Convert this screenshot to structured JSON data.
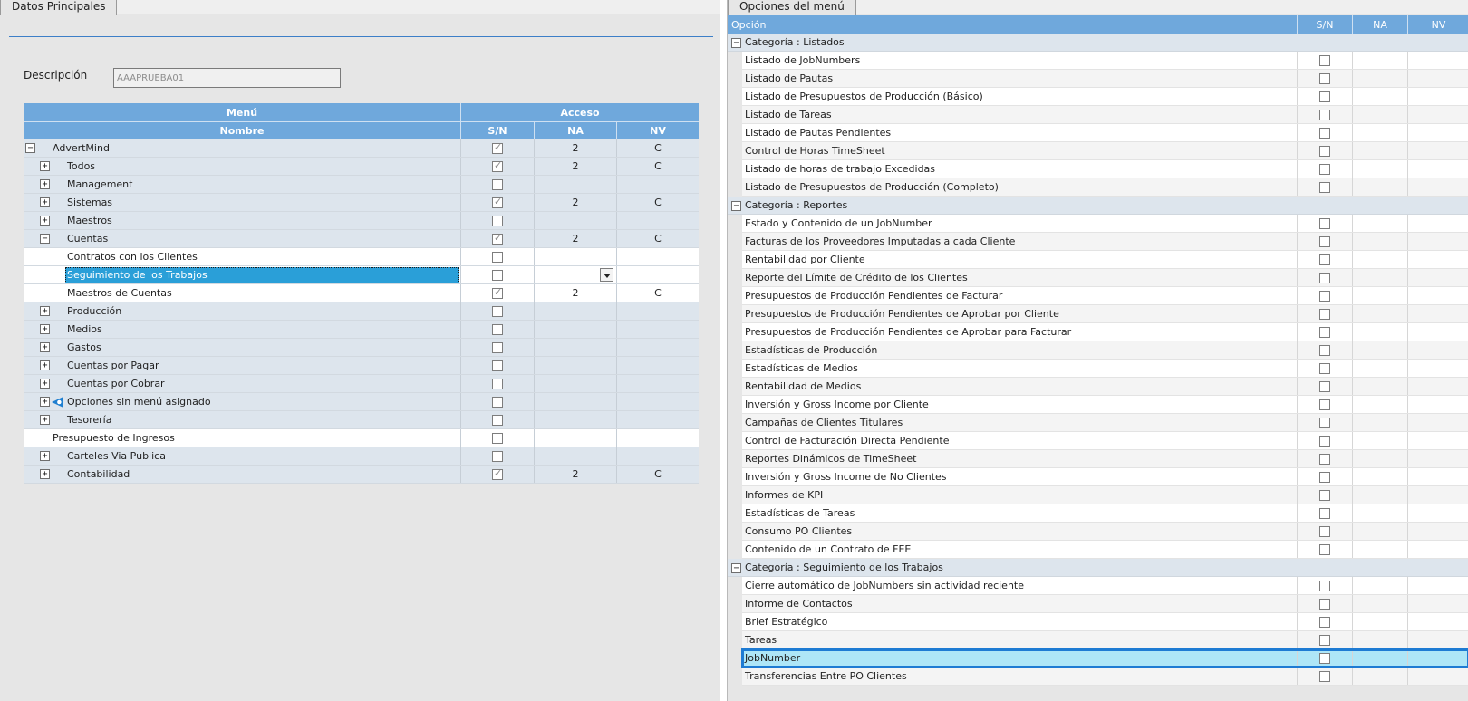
{
  "left": {
    "tab": "Datos Principales",
    "description_label": "Descripción",
    "description_value": "AAAPRUEBA01",
    "header": {
      "menu": "Menú",
      "acceso": "Acceso",
      "nombre": "Nombre",
      "sn": "S/N",
      "na": "NA",
      "nv": "NV"
    },
    "rows": [
      {
        "label": "AdvertMind",
        "level": 0,
        "exp": "−",
        "checked": true,
        "na": "2",
        "nv": "C",
        "white": false
      },
      {
        "label": "Todos",
        "level": 1,
        "exp": "+",
        "checked": true,
        "na": "2",
        "nv": "C",
        "white": false
      },
      {
        "label": "Management",
        "level": 1,
        "exp": "+",
        "checked": false,
        "na": "",
        "nv": "",
        "white": false
      },
      {
        "label": "Sistemas",
        "level": 1,
        "exp": "+",
        "checked": true,
        "na": "2",
        "nv": "C",
        "white": false
      },
      {
        "label": "Maestros",
        "level": 1,
        "exp": "+",
        "checked": false,
        "na": "",
        "nv": "",
        "white": false
      },
      {
        "label": "Cuentas",
        "level": 1,
        "exp": "−",
        "checked": true,
        "na": "2",
        "nv": "C",
        "white": false
      },
      {
        "label": "Contratos con los Clientes",
        "level": 2,
        "exp": "",
        "checked": false,
        "na": "",
        "nv": "",
        "white": true
      },
      {
        "label": "Seguimiento de los Trabajos",
        "level": 2,
        "exp": "",
        "checked": false,
        "na": "",
        "nv": "",
        "white": true,
        "selected": true,
        "dropdown": true
      },
      {
        "label": "Maestros de Cuentas",
        "level": 2,
        "exp": "",
        "checked": true,
        "na": "2",
        "nv": "C",
        "white": true
      },
      {
        "label": "Producción",
        "level": 1,
        "exp": "+",
        "checked": false,
        "na": "",
        "nv": "",
        "white": false
      },
      {
        "label": "Medios",
        "level": 1,
        "exp": "+",
        "checked": false,
        "na": "",
        "nv": "",
        "white": false
      },
      {
        "label": "Gastos",
        "level": 1,
        "exp": "+",
        "checked": false,
        "na": "",
        "nv": "",
        "white": false
      },
      {
        "label": "Cuentas por Pagar",
        "level": 1,
        "exp": "+",
        "checked": false,
        "na": "",
        "nv": "",
        "white": false
      },
      {
        "label": "Cuentas por Cobrar",
        "level": 1,
        "exp": "+",
        "checked": false,
        "na": "",
        "nv": "",
        "white": false
      },
      {
        "label": "Opciones sin menú asignado",
        "level": 1,
        "exp": "+",
        "checked": false,
        "na": "",
        "nv": "",
        "white": false,
        "warn": true
      },
      {
        "label": "Tesorería",
        "level": 1,
        "exp": "+",
        "checked": false,
        "na": "",
        "nv": "",
        "white": false
      },
      {
        "label": "Presupuesto de Ingresos",
        "level": 0.5,
        "exp": "",
        "checked": false,
        "na": "",
        "nv": "",
        "white": true
      },
      {
        "label": "Carteles Via Publica",
        "level": 1,
        "exp": "+",
        "checked": false,
        "na": "",
        "nv": "",
        "white": false
      },
      {
        "label": "Contabilidad",
        "level": 1,
        "exp": "+",
        "checked": true,
        "na": "2",
        "nv": "C",
        "white": false
      }
    ]
  },
  "right": {
    "tab": "Opciones del menú",
    "header": {
      "opcion": "Opción",
      "sn": "S/N",
      "na": "NA",
      "nv": "NV"
    },
    "groups": [
      {
        "category": "Categoría : Listados",
        "items": [
          "Listado de JobNumbers",
          "Listado de Pautas",
          "Listado de Presupuestos de Producción (Básico)",
          "Listado de Tareas",
          "Listado de Pautas Pendientes",
          "Control de Horas TimeSheet",
          "Listado de horas de trabajo Excedidas",
          "Listado de Presupuestos de Producción (Completo)"
        ]
      },
      {
        "category": "Categoría : Reportes",
        "items": [
          "Estado y Contenido de un JobNumber",
          "Facturas de los Proveedores Imputadas a cada Cliente",
          "Rentabilidad por Cliente",
          "Reporte del Límite de Crédito de los Clientes",
          "Presupuestos de Producción Pendientes de Facturar",
          "Presupuestos de Producción Pendientes de Aprobar por Cliente",
          "Presupuestos de Producción Pendientes de Aprobar para Facturar",
          "Estadísticas de Producción",
          "Estadísticas de Medios",
          "Rentabilidad de Medios",
          "Inversión y Gross Income por Cliente",
          "Campañas de Clientes Titulares",
          "Control de Facturación Directa Pendiente",
          "Reportes Dinámicos de TimeSheet",
          "Inversión y Gross Income de No Clientes",
          "Informes de KPI",
          "Estadísticas de Tareas",
          "Consumo PO Clientes",
          "Contenido de un Contrato de FEE"
        ]
      },
      {
        "category": "Categoría : Seguimiento de los Trabajos",
        "items": [
          "Cierre automático de JobNumbers sin actividad reciente",
          "Informe de Contactos",
          "Brief Estratégico",
          "Tareas",
          "JobNumber",
          "Transferencias Entre PO Clientes"
        ],
        "selected_index": 4
      }
    ]
  },
  "icons": {
    "expand": "plus-box-icon",
    "collapse": "minus-box-icon",
    "warning": "warning-shield-icon"
  },
  "colors": {
    "header_blue": "#6fa8dc",
    "selection_blue": "#2a9fd8",
    "row_tint": "#dde5ed",
    "focus_outline": "#1e7bd3"
  }
}
